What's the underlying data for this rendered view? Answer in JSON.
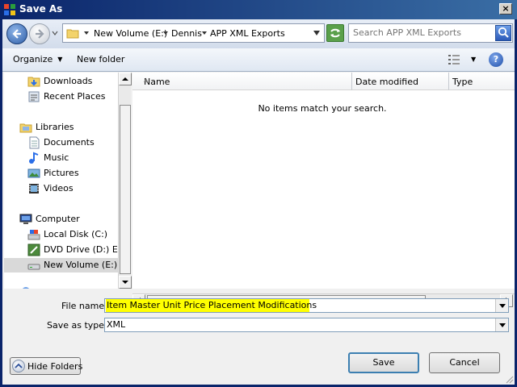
{
  "window": {
    "title": "Save As"
  },
  "address": {
    "crumbs": [
      "New Volume (E:)",
      "Dennis",
      "APP XML Exports"
    ]
  },
  "search": {
    "placeholder": "Search APP XML Exports"
  },
  "toolbar": {
    "organize": "Organize",
    "new_folder": "New folder",
    "help": "?"
  },
  "nav": {
    "items": [
      {
        "label": "Downloads",
        "icon": "downloads-icon",
        "indent": 1
      },
      {
        "label": "Recent Places",
        "icon": "recent-places-icon",
        "indent": 1
      },
      {
        "label": "Libraries",
        "icon": "libraries-icon",
        "indent": 0
      },
      {
        "label": "Documents",
        "icon": "documents-icon",
        "indent": 1
      },
      {
        "label": "Music",
        "icon": "music-icon",
        "indent": 1
      },
      {
        "label": "Pictures",
        "icon": "pictures-icon",
        "indent": 1
      },
      {
        "label": "Videos",
        "icon": "videos-icon",
        "indent": 1
      },
      {
        "label": "Computer",
        "icon": "computer-icon",
        "indent": 0
      },
      {
        "label": "Local Disk (C:)",
        "icon": "local-disk-icon",
        "indent": 1
      },
      {
        "label": "DVD Drive (D:) ENL",
        "icon": "dvd-drive-icon",
        "indent": 1
      },
      {
        "label": "New Volume (E:)",
        "icon": "drive-icon",
        "indent": 1,
        "selected": true
      }
    ]
  },
  "filelist": {
    "columns": [
      "Name",
      "Date modified",
      "Type"
    ],
    "empty_message": "No items match your search."
  },
  "form": {
    "file_name_label": "File name:",
    "file_name_value": "Item Master Unit Price Placement Modifications",
    "highlight_color": "#ffff00",
    "save_type_label": "Save as type:",
    "save_type_value": "XML"
  },
  "buttons": {
    "hide_folders": "Hide Folders",
    "save": "Save",
    "cancel": "Cancel"
  }
}
